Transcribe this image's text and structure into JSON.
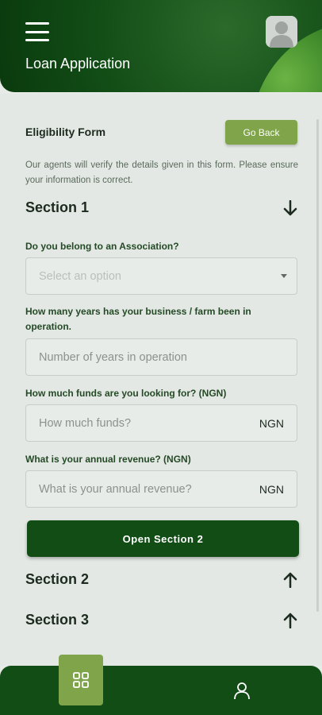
{
  "header": {
    "title": "Loan Application",
    "icons": {
      "menu": "hamburger-menu-icon",
      "avatar": "user-avatar-icon"
    }
  },
  "form": {
    "title": "Eligibility Form",
    "go_back_label": "Go Back",
    "intro": "Our agents will verify the details given in this form. Please ensure your information is correct."
  },
  "section1": {
    "label": "Section 1",
    "arrow": "arrow-down-icon",
    "questions": {
      "association": {
        "label": "Do you belong to an Association?",
        "placeholder": "Select an option"
      },
      "years": {
        "label": "How many years has your business / farm been in operation.",
        "placeholder": "Number of years in operation"
      },
      "funds": {
        "label": "How much funds are you looking for? (NGN)",
        "placeholder": "How much funds?",
        "unit": "NGN"
      },
      "revenue": {
        "label": "What is your annual revenue? (NGN)",
        "placeholder": "What is your annual revenue?",
        "unit": "NGN"
      }
    },
    "open_next_label": "Open Section 2"
  },
  "section2": {
    "label": "Section 2",
    "arrow": "arrow-up-icon"
  },
  "section3": {
    "label": "Section 3",
    "arrow": "arrow-up-icon"
  },
  "bottom_nav": {
    "home_icon": "grid-icon",
    "profile_icon": "person-icon"
  },
  "colors": {
    "primary": "#124d16",
    "accent": "#7fa44a",
    "background": "#e3e8e4"
  }
}
